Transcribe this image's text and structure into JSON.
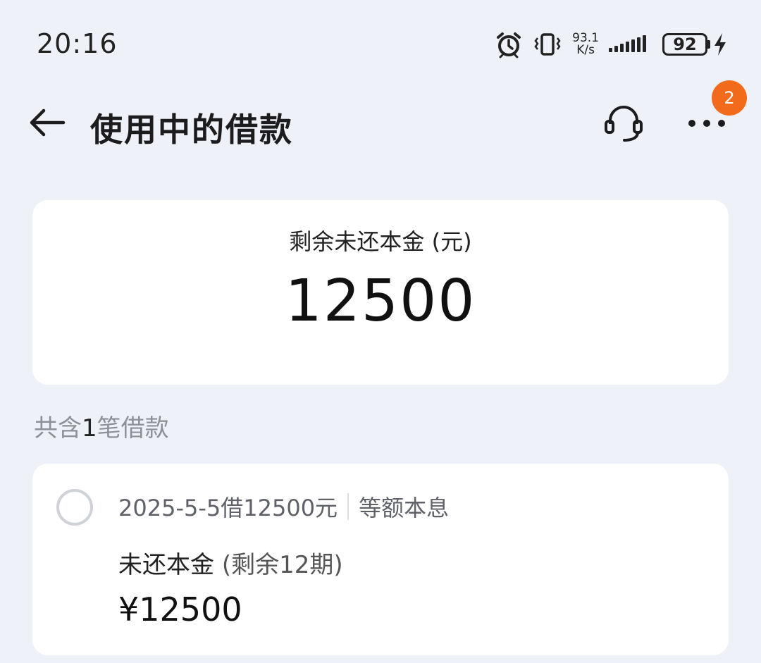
{
  "status_bar": {
    "time": "20:16",
    "net_speed_value": "93.1",
    "net_speed_unit": "K/s",
    "battery": "92"
  },
  "header": {
    "title": "使用中的借款",
    "badge_count": "2"
  },
  "summary": {
    "label": "剩余未还本金 (元)",
    "amount": "12500"
  },
  "loan_count": {
    "prefix": "共含",
    "count": "1",
    "suffix": "笔借款"
  },
  "loans": [
    {
      "date_desc": "2025-5-5借12500元",
      "method": "等额本息",
      "remaining_label": "未还本金",
      "remaining_periods": "(剩余12期)",
      "amount": "¥12500"
    }
  ],
  "colors": {
    "background": "#eef1f7",
    "card": "#ffffff",
    "badge": "#f26a1b",
    "muted_text": "#8d9098"
  }
}
